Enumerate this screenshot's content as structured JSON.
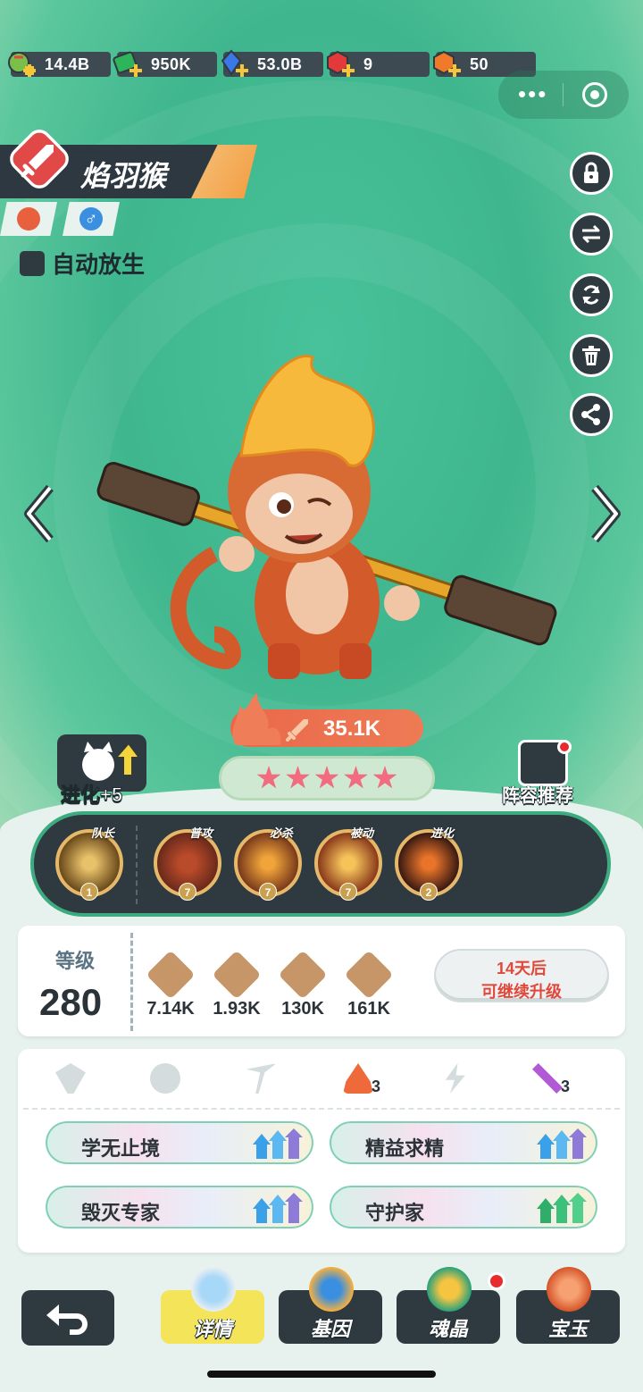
{
  "resources": [
    {
      "icon": "green-potion-icon",
      "value": "14.4B",
      "color": "#7bbf4b"
    },
    {
      "icon": "green-cash-icon",
      "value": "950K",
      "color": "#2fb35b"
    },
    {
      "icon": "blue-crystal-icon",
      "value": "53.0B",
      "color": "#3a78e8"
    },
    {
      "icon": "red-gem-icon",
      "value": "9",
      "color": "#e23a3a"
    },
    {
      "icon": "orange-gem-icon",
      "value": "50",
      "color": "#f07a2a"
    }
  ],
  "pet": {
    "name": "焰羽猴",
    "element_icon": "fire-icon",
    "gender_icon": "male-icon",
    "auto_release_label": "自动放生",
    "power": "35.1K",
    "stars": [
      "★",
      "★",
      "★",
      "★",
      "★"
    ]
  },
  "side_actions": [
    "lock-icon",
    "swap-icon",
    "refresh-icon",
    "trash-icon",
    "share-icon"
  ],
  "evolve_label": "进化+5",
  "lineup_label": "阵容推荐",
  "skills": [
    {
      "tag": "队长",
      "level": "1"
    },
    {
      "tag": "普攻",
      "level": "7"
    },
    {
      "tag": "必杀",
      "level": "7"
    },
    {
      "tag": "被动",
      "level": "7"
    },
    {
      "tag": "进化",
      "level": "2"
    }
  ],
  "stats": {
    "level_label": "等级",
    "level_value": "280",
    "attack": "7.14K",
    "defense": "1.93K",
    "hp": "130K",
    "power_stat": "161K",
    "upgrade_line1": "14天后",
    "upgrade_line2": "可继续升级"
  },
  "trait_icons": [
    {
      "icon": "sprout-icon",
      "count": ""
    },
    {
      "icon": "cloud-icon",
      "count": ""
    },
    {
      "icon": "pickaxe-icon",
      "count": ""
    },
    {
      "icon": "campfire-icon",
      "count": "3"
    },
    {
      "icon": "lightning-icon",
      "count": ""
    },
    {
      "icon": "tools-icon",
      "count": "3"
    }
  ],
  "traits": [
    "学无止境",
    "精益求精",
    "毁灭专家",
    "守护家"
  ],
  "nav": [
    {
      "label": "详情",
      "icon": "magnifier-icon"
    },
    {
      "label": "基因",
      "icon": "dna-icon"
    },
    {
      "label": "魂晶",
      "icon": "paw-card-icon"
    },
    {
      "label": "宝玉",
      "icon": "crystal-cluster-icon"
    }
  ]
}
